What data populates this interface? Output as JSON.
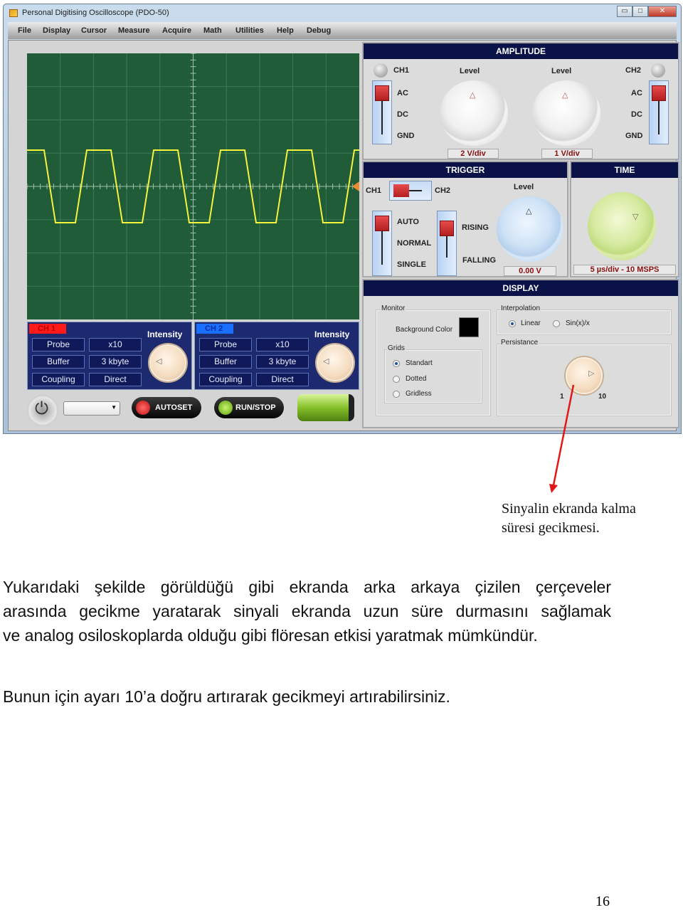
{
  "window": {
    "title": "Personal Digitising Oscilloscope (PDO-50)",
    "controls": [
      "▭",
      "□",
      "✕"
    ]
  },
  "menu": [
    "File",
    "Display",
    "Cursor",
    "Measure",
    "Acquire",
    "Math",
    "Utilities",
    "Help",
    "Debug"
  ],
  "channels": [
    {
      "tag": "CH 1",
      "tag_color": "#ff1a1a",
      "rows": [
        [
          "Probe",
          "x10"
        ],
        [
          "Buffer",
          "3 kbyte"
        ],
        [
          "Coupling",
          "Direct"
        ]
      ],
      "intensity": "Intensity"
    },
    {
      "tag": "CH 2",
      "tag_color": "#1a6fff",
      "rows": [
        [
          "Probe",
          "x10"
        ],
        [
          "Buffer",
          "3 kbyte"
        ],
        [
          "Coupling",
          "Direct"
        ]
      ],
      "intensity": "Intensity"
    }
  ],
  "bottom": {
    "autoset": "AUTOSET",
    "runstop": "RUN/STOP",
    "dropdown_value": ""
  },
  "amplitude": {
    "title": "AMPLITUDE",
    "ch1": "CH1",
    "ch2": "CH2",
    "level": "Level",
    "coupling": [
      "AC",
      "DC",
      "GND"
    ],
    "ch1_value": "2 V/div",
    "ch2_value": "1 V/div"
  },
  "trigger": {
    "title": "TRIGGER",
    "ch1": "CH1",
    "ch2": "CH2",
    "level": "Level",
    "modes": [
      "AUTO",
      "NORMAL",
      "SINGLE"
    ],
    "edges": [
      "RISING",
      "FALLING"
    ],
    "value": "0.00 V"
  },
  "time": {
    "title": "TIME",
    "value": "5 µs/div - 10 MSPS"
  },
  "display": {
    "title": "DISPLAY",
    "monitor": "Monitor",
    "background_color_label": "Background Color",
    "background_color": "#000000",
    "grids_label": "Grids",
    "grids": [
      "Standart",
      "Dotted",
      "Gridless"
    ],
    "grid_selected": "Standart",
    "interpolation_label": "Interpolation",
    "interpolation": [
      "Linear",
      "Sin(x)/x"
    ],
    "interpolation_selected": "Linear",
    "persistance_label": "Persistance",
    "persistance_min": "1",
    "persistance_max": "10",
    "persistance_value": 1
  },
  "colors": {
    "screen": "#1f5c37",
    "trace": "#f4f43c",
    "annotation_arrow": "#e01818"
  },
  "annotation": {
    "line1": "Sinyalin ekranda kalma",
    "line2": "süresi gecikmesi."
  },
  "paragraph1": [
    "Yukarıdaki şekilde görüldüğü gibi ekranda arka arkaya çizilen çerçeveler",
    "arasında gecikme yaratarak sinyali ekranda uzun süre durmasını sağlamak",
    "ve analog osiloskoplarda olduğu gibi flöresan etkisi yaratmak mümkündür."
  ],
  "paragraph2": "Bunun için ayarı 10’a doğru artırarak gecikmeyi artırabilirsiniz.",
  "page_number": "16"
}
